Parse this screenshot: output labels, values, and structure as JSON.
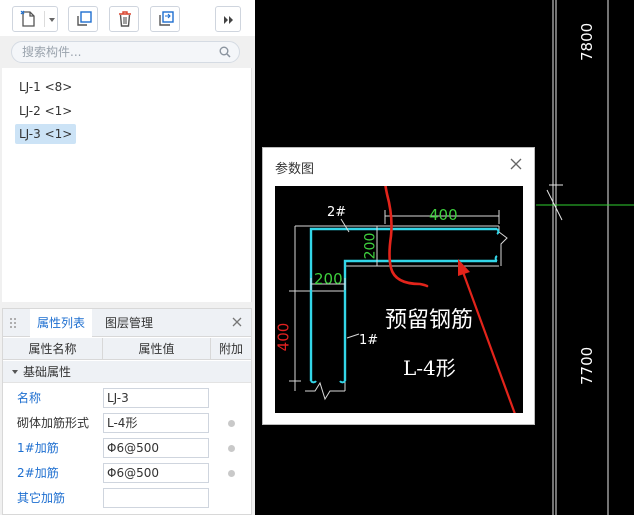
{
  "toolbar": {
    "buttons": [
      "new-component-icon",
      "copy-icon",
      "delete-icon",
      "copy-to-floor-icon",
      "more-icon"
    ]
  },
  "search": {
    "placeholder": "搜索构件..."
  },
  "components": [
    {
      "label": "LJ-1 <8>",
      "selected": false
    },
    {
      "label": "LJ-2 <1>",
      "selected": false
    },
    {
      "label": "LJ-3 <1>",
      "selected": true
    }
  ],
  "properties": {
    "tab_active": "属性列表",
    "tab_inactive": "图层管理",
    "col_name": "属性名称",
    "col_value": "属性值",
    "col_extra": "附加",
    "group": "基础属性",
    "rows": [
      {
        "label": "名称",
        "value": "LJ-3",
        "color": "blue"
      },
      {
        "label": "砌体加筋形式",
        "value": "L-4形",
        "color": "black"
      },
      {
        "label": "1#加筋",
        "value": "Φ6@500",
        "color": "blue"
      },
      {
        "label": "2#加筋",
        "value": "Φ6@500",
        "color": "blue"
      },
      {
        "label": "其它加筋",
        "value": "",
        "color": "blue"
      }
    ]
  },
  "cad": {
    "dim_top": "7800",
    "dim_bottom": "7700"
  },
  "dialog": {
    "title": "参数图",
    "label_2": "2#",
    "label_1": "1#",
    "dim_400_top": "400",
    "dim_200_vert": "200",
    "dim_200_horiz": "200",
    "dim_400_left": "400",
    "annotation_1": "预留钢筋",
    "annotation_2": "L-4形"
  },
  "colors": {
    "rebar": "#33d6e8",
    "dim_green": "#3ecf3e",
    "dim_red": "#e02020",
    "annotation_red": "#e3241b",
    "selection": "#cce3f6",
    "link_blue": "#1e6fd0"
  }
}
